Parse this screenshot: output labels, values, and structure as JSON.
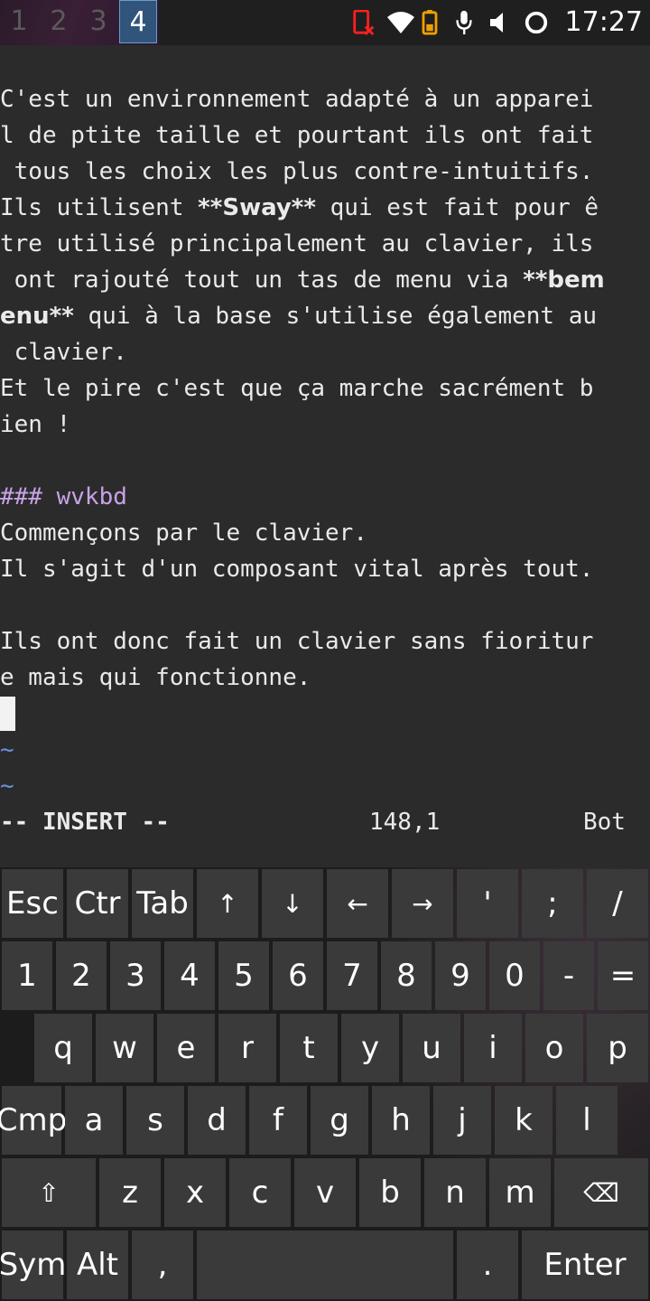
{
  "statusbar": {
    "workspaces": [
      "1",
      "2",
      "3",
      "4"
    ],
    "active_workspace": "4",
    "icons": [
      "phone-disconnected-icon",
      "wifi-icon",
      "battery-icon",
      "microphone-icon",
      "speaker-muted-icon",
      "circle-indicator-icon"
    ],
    "clock": "17:27",
    "colors": {
      "alert": "#ff2020",
      "battery": "#f0a000"
    }
  },
  "editor": {
    "p1": [
      "C'est un environnement adapté à un apparei",
      "l de ptite taille et pourtant ils ont fait",
      " tous les choix les plus contre-intuitifs."
    ],
    "p2_l1_a": "Ils utilisent ",
    "p2_l1_b": "**Sway**",
    "p2_l1_c": " qui est fait pour ê",
    "p2_l2": "tre utilisé principalement au clavier, ils",
    "p2_l3_a": " ont rajouté tout un tas de menu via ",
    "p2_l3_b": "**bem",
    "p2_l4_a": "enu**",
    "p2_l4_b": " qui à la base s'utilise également au",
    "p2_l5": " clavier.",
    "p3": [
      "Et le pire c'est que ça marche sacrément b",
      "ien !"
    ],
    "heading": "### wvkbd",
    "p4": [
      "Commençons par le clavier.",
      "Il s'agit d'un composant vital après tout."
    ],
    "p5": [
      "Ils ont donc fait un clavier sans fioritur",
      "e mais qui fonctionne."
    ],
    "tilde": "~",
    "mode": "-- INSERT --",
    "position": "148,1",
    "scroll": "Bot"
  },
  "keyboard": {
    "row1": [
      "Esc",
      "Ctr",
      "Tab",
      "↑",
      "↓",
      "←",
      "→",
      "'",
      ";",
      "/"
    ],
    "row2": [
      "1",
      "2",
      "3",
      "4",
      "5",
      "6",
      "7",
      "8",
      "9",
      "0",
      "-",
      "="
    ],
    "row3": [
      "q",
      "w",
      "e",
      "r",
      "t",
      "y",
      "u",
      "i",
      "o",
      "p"
    ],
    "row4": [
      "Cmp",
      "a",
      "s",
      "d",
      "f",
      "g",
      "h",
      "j",
      "k",
      "l"
    ],
    "row5": [
      "⇧",
      "z",
      "x",
      "c",
      "v",
      "b",
      "n",
      "m",
      "⌫"
    ],
    "row6": [
      "Sym",
      "Alt",
      ",",
      "",
      ".",
      "Enter"
    ]
  }
}
